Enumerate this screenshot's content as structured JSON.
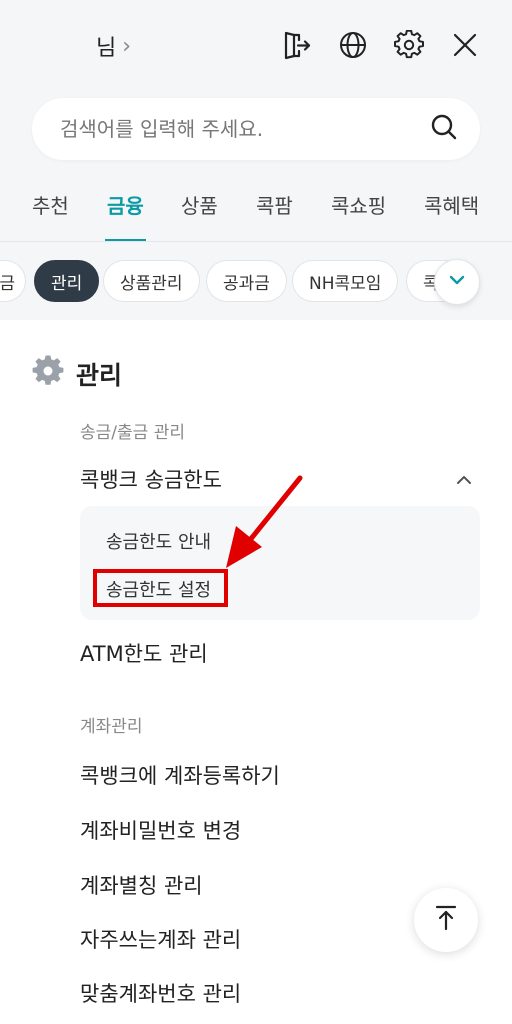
{
  "header": {
    "user_suffix": "님",
    "chevron": "›",
    "icons": [
      "logout-icon",
      "globe-icon",
      "gear-icon",
      "close-icon"
    ]
  },
  "search": {
    "placeholder": "검색어를 입력해 주세요.",
    "value": ""
  },
  "main_tabs": [
    "추천",
    "금융",
    "상품",
    "콕팜",
    "콕쇼핑",
    "콕혜택"
  ],
  "main_tabs_active": "금융",
  "chips": [
    "금",
    "관리",
    "상품관리",
    "공과금",
    "NH콕모임",
    "콕"
  ],
  "chips_active": "관리",
  "section": {
    "title": "관리",
    "groups": [
      {
        "label": "송금/출금 관리",
        "items": [
          {
            "label": "콕뱅크 송금한도",
            "expanded": true,
            "subitems": [
              "송금한도 안내",
              "송금한도 설정"
            ]
          },
          {
            "label": "ATM한도 관리"
          }
        ]
      },
      {
        "label": "계좌관리",
        "items": [
          {
            "label": "콕뱅크에 계좌등록하기"
          },
          {
            "label": "계좌비밀번호 변경"
          },
          {
            "label": "계좌별칭 관리"
          },
          {
            "label": "자주쓰는계좌 관리"
          },
          {
            "label": "맞춤계좌번호 관리"
          }
        ]
      }
    ]
  },
  "colors": {
    "accent": "#0a9ba5",
    "chip_active": "#2f3b46",
    "annotation": "#e00000",
    "header_bg": "#f4f6f8"
  }
}
